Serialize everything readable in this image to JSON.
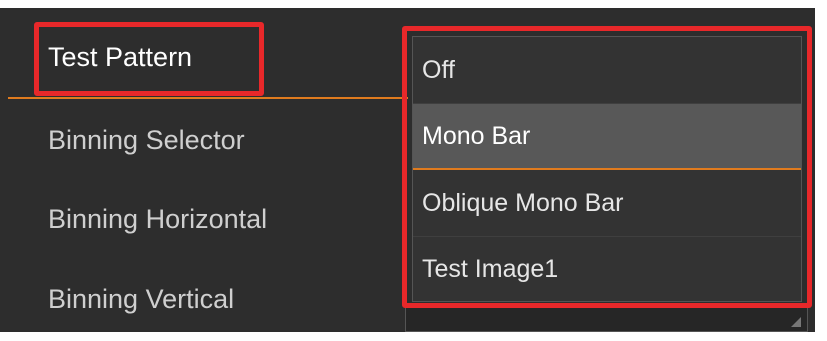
{
  "properties": [
    {
      "label": "Test Pattern"
    },
    {
      "label": "Binning Selector"
    },
    {
      "label": "Binning Horizontal"
    },
    {
      "label": "Binning Vertical"
    }
  ],
  "dropdown": {
    "options": [
      {
        "label": "Off"
      },
      {
        "label": "Mono Bar"
      },
      {
        "label": "Oblique Mono Bar"
      },
      {
        "label": "Test Image1"
      }
    ],
    "highlighted": "Mono Bar"
  },
  "colors": {
    "panel_bg": "#2d2d2d",
    "accent": "#e07b1e",
    "highlight_box": "#e8282a",
    "selected_option_bg": "#585858"
  }
}
